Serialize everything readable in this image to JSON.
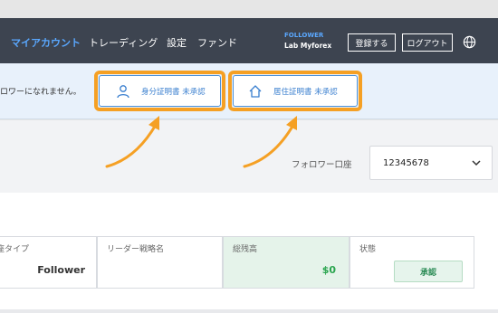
{
  "nav": {
    "items": [
      "マイアカウント",
      "トレーディング",
      "設定",
      "ファンド"
    ],
    "brand_line1": "FOLLOWER",
    "brand_line2": "Lab Myforex",
    "register_label": "登録する",
    "logout_label": "ログアウト",
    "globe_icon": "globe-icon"
  },
  "notice": {
    "text": "ロワーになれません。",
    "id_doc_label": "身分証明書 未承認",
    "address_doc_label": "居住証明書 未承認",
    "highlight_color": "#f5a024"
  },
  "account": {
    "label": "フォロワー口座",
    "value": "12345678"
  },
  "table": {
    "type_label": "座タイプ",
    "type_value": "Follower",
    "strategy_label": "リーダー戦略名",
    "balance_label": "総残高",
    "balance_value": "$0",
    "status_label": "状態",
    "status_value": "承認"
  },
  "colors": {
    "topbar": "#3d4450",
    "accent": "#5aa8ff",
    "green": "#2aa54f"
  }
}
